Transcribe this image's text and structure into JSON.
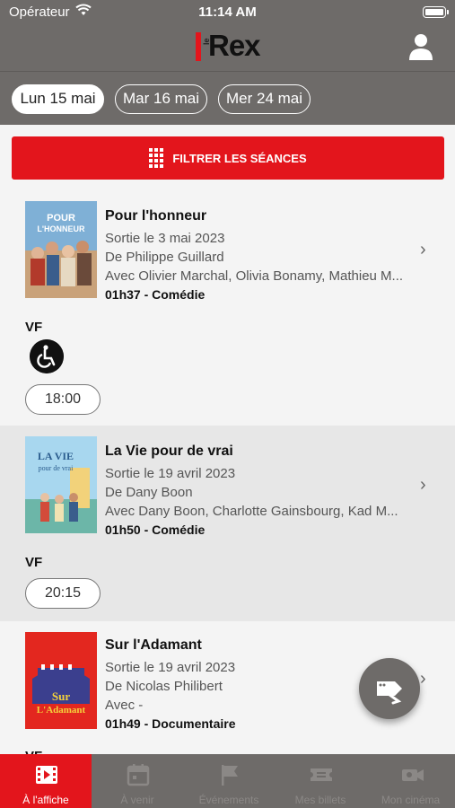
{
  "status_bar": {
    "carrier": "Opérateur",
    "time": "11:14 AM"
  },
  "header": {
    "logo_prefix": "le",
    "logo_text": "Rex"
  },
  "dates": [
    {
      "label": "Lun 15 mai",
      "active": true
    },
    {
      "label": "Mar 16 mai",
      "active": false
    },
    {
      "label": "Mer 24 mai",
      "active": false
    }
  ],
  "filter": {
    "label": "FILTRER LES SÉANCES"
  },
  "movies": [
    {
      "title": "Pour l'honneur",
      "release": "Sortie le 3 mai 2023",
      "director": "De Philippe Guillard",
      "cast": "Avec Olivier Marchal, Olivia Bonamy, Mathieu M...",
      "duration": "01h37 - Comédie",
      "version": "VF",
      "accessible": true,
      "showtimes": [
        "18:00"
      ]
    },
    {
      "title": "La Vie pour de vrai",
      "release": "Sortie le 19 avril 2023",
      "director": "De Dany Boon",
      "cast": "Avec Dany Boon, Charlotte Gainsbourg, Kad M...",
      "duration": "01h50 - Comédie",
      "version": "VF",
      "accessible": false,
      "showtimes": [
        "20:15"
      ]
    },
    {
      "title": "Sur l'Adamant",
      "release": "Sortie le 19 avril 2023",
      "director": "De Nicolas Philibert",
      "cast": "Avec -",
      "duration": "01h49 - Documentaire",
      "version": "VF",
      "accessible": false,
      "showtimes": []
    }
  ],
  "tabs": [
    {
      "label": "À l'affiche",
      "icon": "film-icon",
      "active": true
    },
    {
      "label": "À venir",
      "icon": "calendar-icon",
      "active": false
    },
    {
      "label": "Événements",
      "icon": "flag-icon",
      "active": false
    },
    {
      "label": "Mes billets",
      "icon": "ticket-icon",
      "active": false
    },
    {
      "label": "Mon cinéma",
      "icon": "camera-icon",
      "active": false
    }
  ],
  "colors": {
    "accent": "#e3151c",
    "header_bg": "#6e6b69",
    "alt_row": "#e7e7e7"
  }
}
